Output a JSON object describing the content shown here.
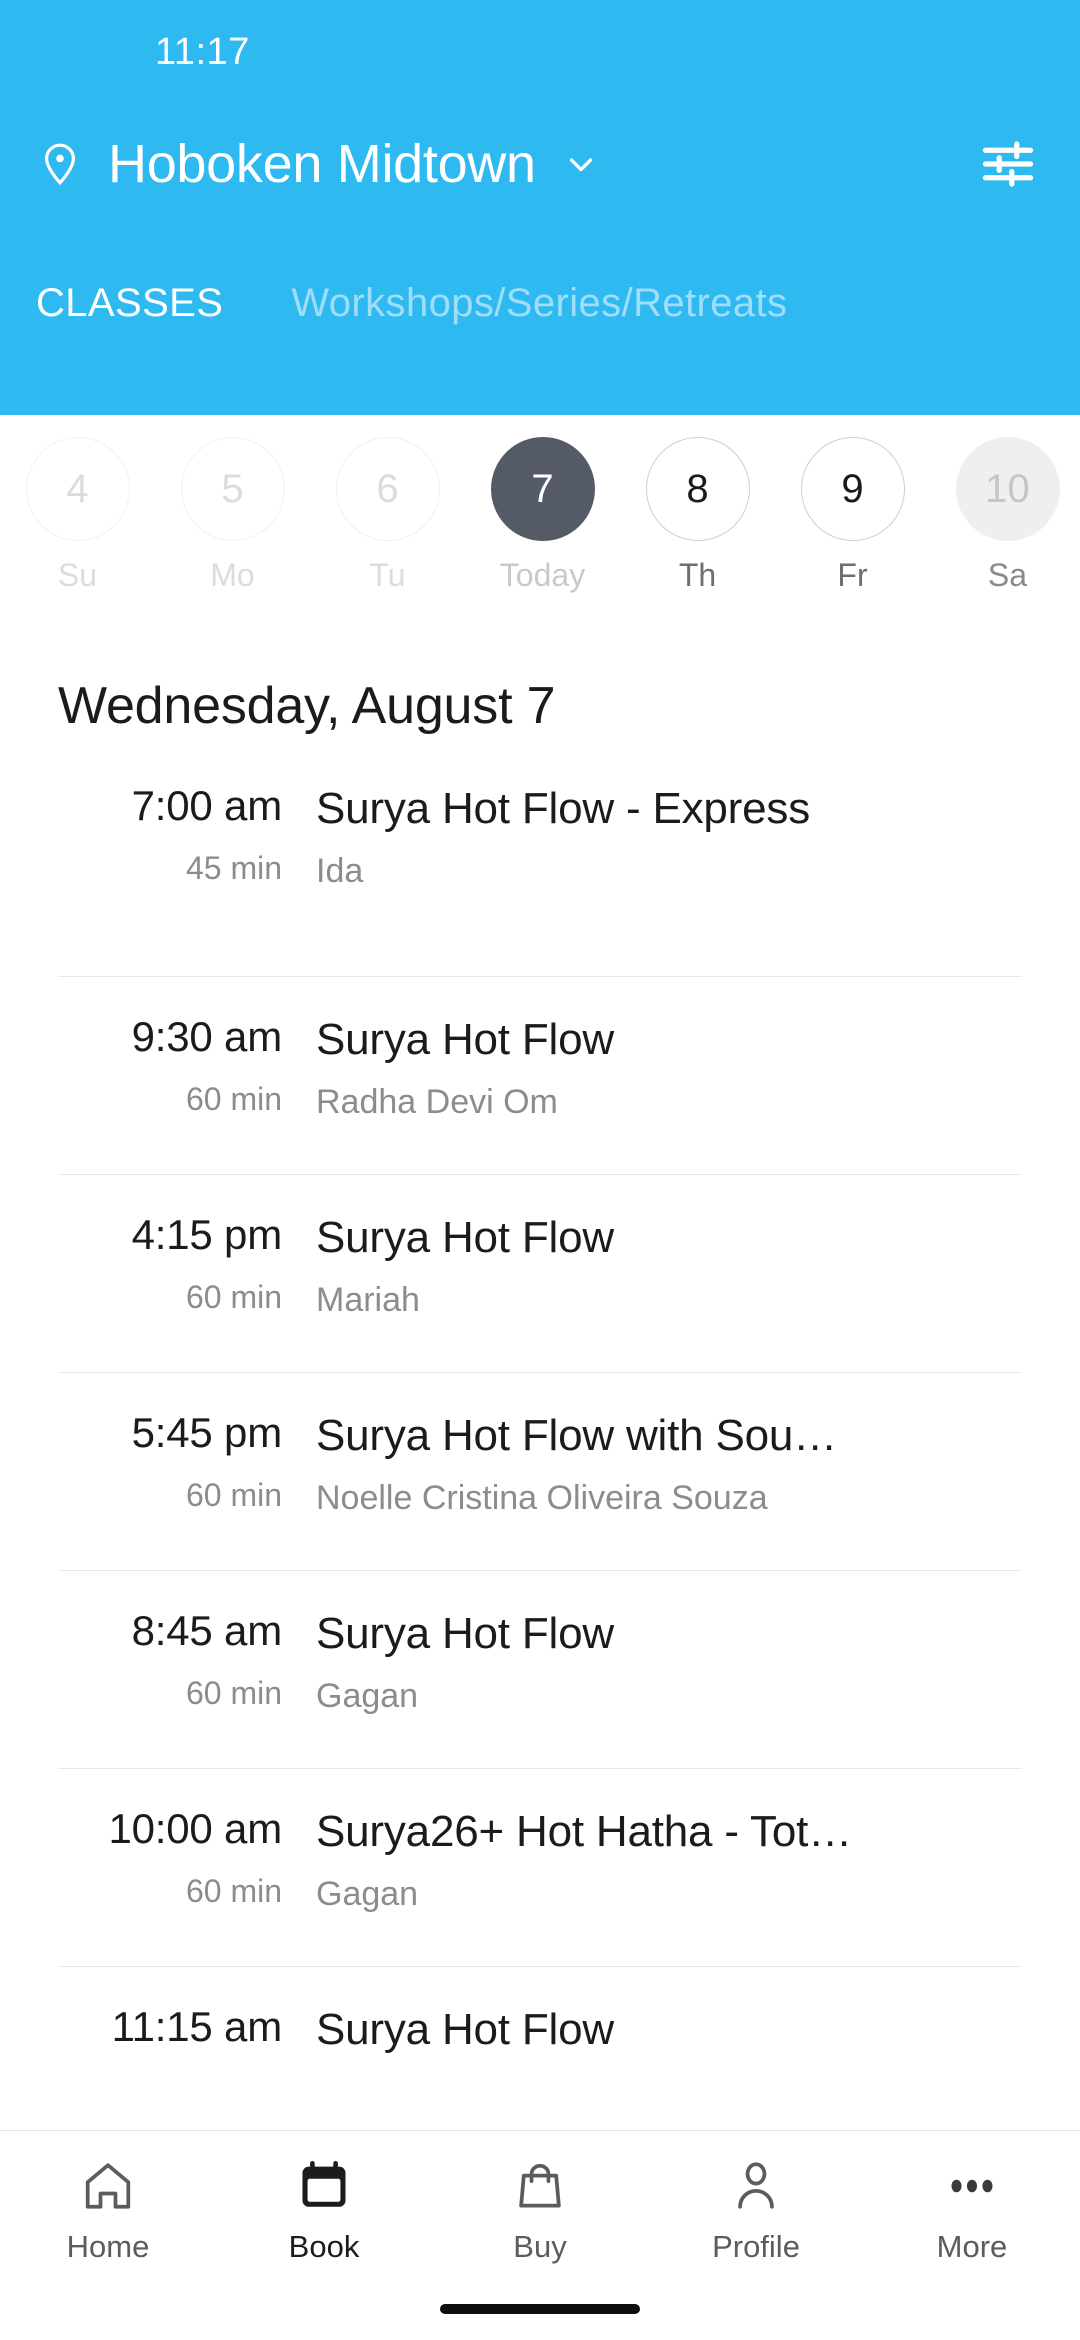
{
  "status_bar": {
    "time": "11:17"
  },
  "header": {
    "location_icon": "location-pin-icon",
    "location_name": "Hoboken Midtown",
    "chevron_icon": "chevron-down-icon",
    "filter_icon": "tune-filter-icon",
    "accent_color": "#2FB9F1",
    "tabs": [
      {
        "label": "CLASSES",
        "active": true
      },
      {
        "label": "Workshops/Series/Retreats",
        "active": false
      }
    ]
  },
  "date_strip": {
    "selected_color": "#555B66",
    "days": [
      {
        "num": "4",
        "label": "Su",
        "state": "past"
      },
      {
        "num": "5",
        "label": "Mo",
        "state": "past"
      },
      {
        "num": "6",
        "label": "Tu",
        "state": "past"
      },
      {
        "num": "7",
        "label": "Today",
        "state": "today"
      },
      {
        "num": "8",
        "label": "Th",
        "state": "future"
      },
      {
        "num": "9",
        "label": "Fr",
        "state": "future"
      },
      {
        "num": "10",
        "label": "Sa",
        "state": "edge"
      }
    ]
  },
  "schedule": {
    "day_heading": "Wednesday, August 7",
    "classes": [
      {
        "time": "7:00 am",
        "duration": "45 min",
        "title": "Surya Hot Flow - Express",
        "teacher": "Ida"
      },
      {
        "time": "9:30 am",
        "duration": "60 min",
        "title": "Surya Hot Flow",
        "teacher": "Radha Devi Om"
      },
      {
        "time": "4:15 pm",
        "duration": "60 min",
        "title": "Surya Hot Flow",
        "teacher": "Mariah"
      },
      {
        "time": "5:45 pm",
        "duration": "60 min",
        "title": "Surya Hot Flow with Sou…",
        "teacher": "Noelle Cristina Oliveira Souza"
      },
      {
        "time": "8:45 am",
        "duration": "60 min",
        "title": "Surya Hot Flow",
        "teacher": "Gagan"
      },
      {
        "time": "10:00 am",
        "duration": "60 min",
        "title": "Surya26+ Hot Hatha - Tot…",
        "teacher": "Gagan"
      },
      {
        "time": "11:15 am",
        "duration": "",
        "title": "Surya Hot Flow",
        "teacher": ""
      }
    ]
  },
  "bottom_nav": {
    "items": [
      {
        "label": "Home",
        "icon": "home-icon",
        "active": false
      },
      {
        "label": "Book",
        "icon": "calendar-icon",
        "active": true
      },
      {
        "label": "Buy",
        "icon": "shopping-bag-icon",
        "active": false
      },
      {
        "label": "Profile",
        "icon": "person-icon",
        "active": false
      },
      {
        "label": "More",
        "icon": "ellipsis-icon",
        "active": false
      }
    ]
  }
}
